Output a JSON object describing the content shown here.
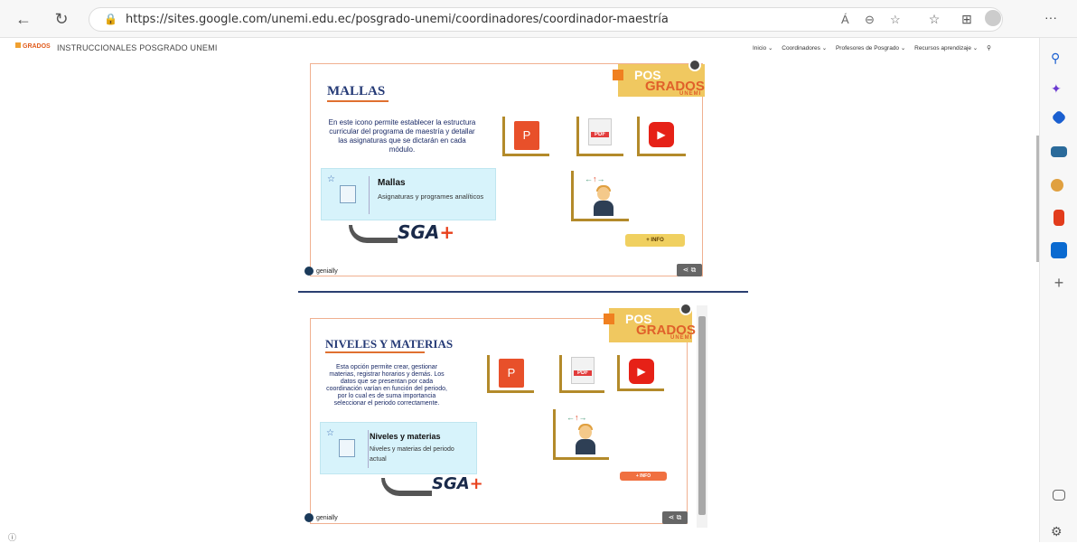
{
  "browser": {
    "url": "https://sites.google.com/unemi.edu.ec/posgrado-unemi/coordinadores/coordinador-maestría",
    "read_aloud": "Á",
    "more": "···"
  },
  "site": {
    "logo_text": "GRADOS",
    "title": "INSTRUCCIONALES POSGRADO UNEMI",
    "nav": [
      "Inicio ⌄",
      "Coordinadores ⌄",
      "Profesores de Posgrado ⌄",
      "Recursos aprendizaje ⌄"
    ]
  },
  "panels": [
    {
      "title": "MALLAS",
      "description": "En este icono permite establecer la estructura curricular del programa de maestría y detallar las asignaturas que se dictarán en cada módulo.",
      "card_title": "Mallas",
      "card_subtitle": "Asignaturas y programes analíticos",
      "sga": "SGA",
      "info": "+ INFO",
      "genially": "genially",
      "badge": {
        "p": "POS",
        "g": "GRADOS",
        "u": "UNEMI"
      }
    },
    {
      "title": "NIVELES Y MATERIAS",
      "description": "Esta opción permite crear, gestionar materias, registrar horarios y demás. Los datos que se presentan por cada coordinación varían en función del periodo, por lo cual es de suma importancia seleccionar el periodo correctamente.",
      "card_title": "Niveles y materias",
      "card_subtitle": "Niveles y materias del periodo actual",
      "sga": "SGA",
      "info": "+ INFO",
      "genially": "genially",
      "badge": {
        "p": "POS",
        "g": "GRADOS",
        "u": "UNEMI"
      }
    }
  ],
  "icons": {
    "ppt": "P",
    "pdf": "PDF",
    "youtube": "▶"
  },
  "colors": {
    "accent": "#e07030",
    "title": "#253a76",
    "badge": "#f0c860",
    "card": "#d7f3fb"
  }
}
